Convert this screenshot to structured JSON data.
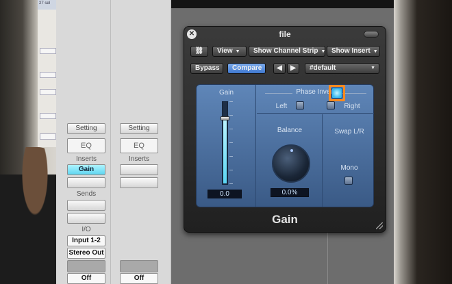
{
  "mini_window": {
    "tab_label": "27 sel"
  },
  "mixer": {
    "strip1": {
      "setting": "Setting",
      "eq": "EQ",
      "inserts_label": "Inserts",
      "insert_slot": "Gain",
      "sends_label": "Sends",
      "io_label": "I/O",
      "input": "Input 1-2",
      "output": "Stereo Out",
      "automation": "Off"
    },
    "strip2": {
      "setting": "Setting",
      "eq": "EQ",
      "inserts_label": "Inserts",
      "automation": "Off"
    }
  },
  "plugin_window": {
    "title": "file",
    "toolbar": {
      "view": "View",
      "show_channel_strip": "Show Channel Strip",
      "show_insert": "Show Insert",
      "bypass": "Bypass",
      "compare": "Compare",
      "preset": "#default"
    },
    "gain": {
      "label": "Gain",
      "value": "0.0",
      "level": 0.8
    },
    "phase_invert": {
      "label": "Phase Invert",
      "left": "Left",
      "right": "Right"
    },
    "balance": {
      "label": "Balance",
      "value": "0.0%"
    },
    "swap": {
      "label": "Swap L/R",
      "active": true
    },
    "mono": {
      "label": "Mono"
    },
    "plugin_name": "Gain"
  },
  "colors": {
    "accent_blue": "#3f78cf",
    "meter_cyan": "#5ad6f4",
    "highlight_orange": "#ff8a1e",
    "panel_blue": "#5f86b8"
  }
}
